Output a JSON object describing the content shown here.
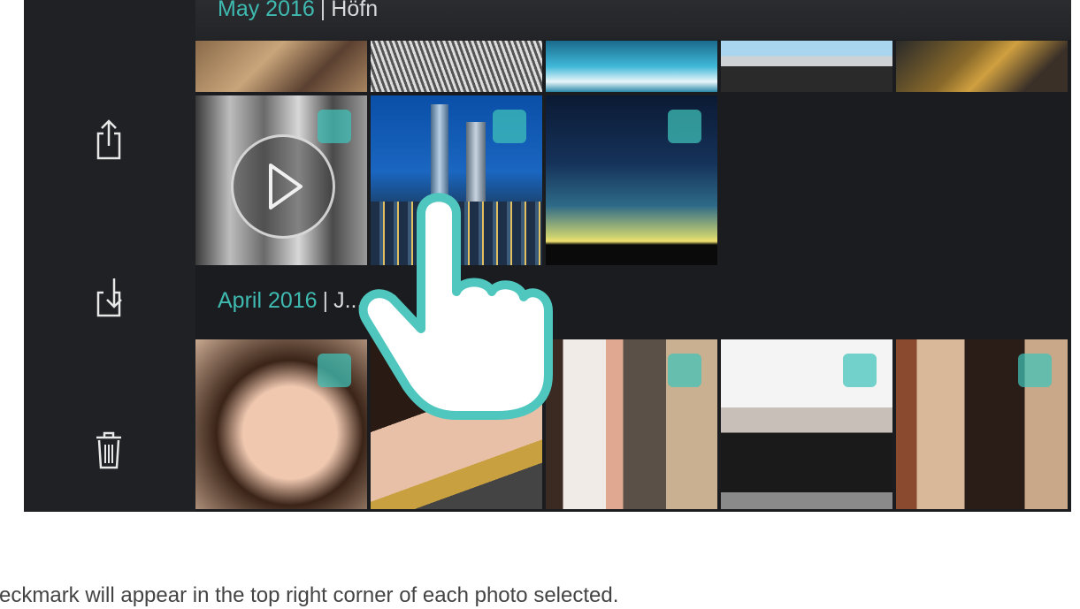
{
  "sections": [
    {
      "date": "May 2016",
      "separator": "|",
      "location": "Höfn"
    },
    {
      "date": "April 2016",
      "separator": "|",
      "location": "J... F..."
    }
  ],
  "sidebar": {
    "actions": [
      {
        "icon": "share-icon"
      },
      {
        "icon": "download-icon"
      },
      {
        "icon": "trash-icon"
      }
    ]
  },
  "gestures": {
    "icon": "pointing-hand-icon"
  },
  "caption": "eckmark will appear in the top right corner of each photo selected.",
  "colors": {
    "accent": "#3fbab1",
    "checkbox": "#40c4ba",
    "background": "#1b1c1f"
  }
}
